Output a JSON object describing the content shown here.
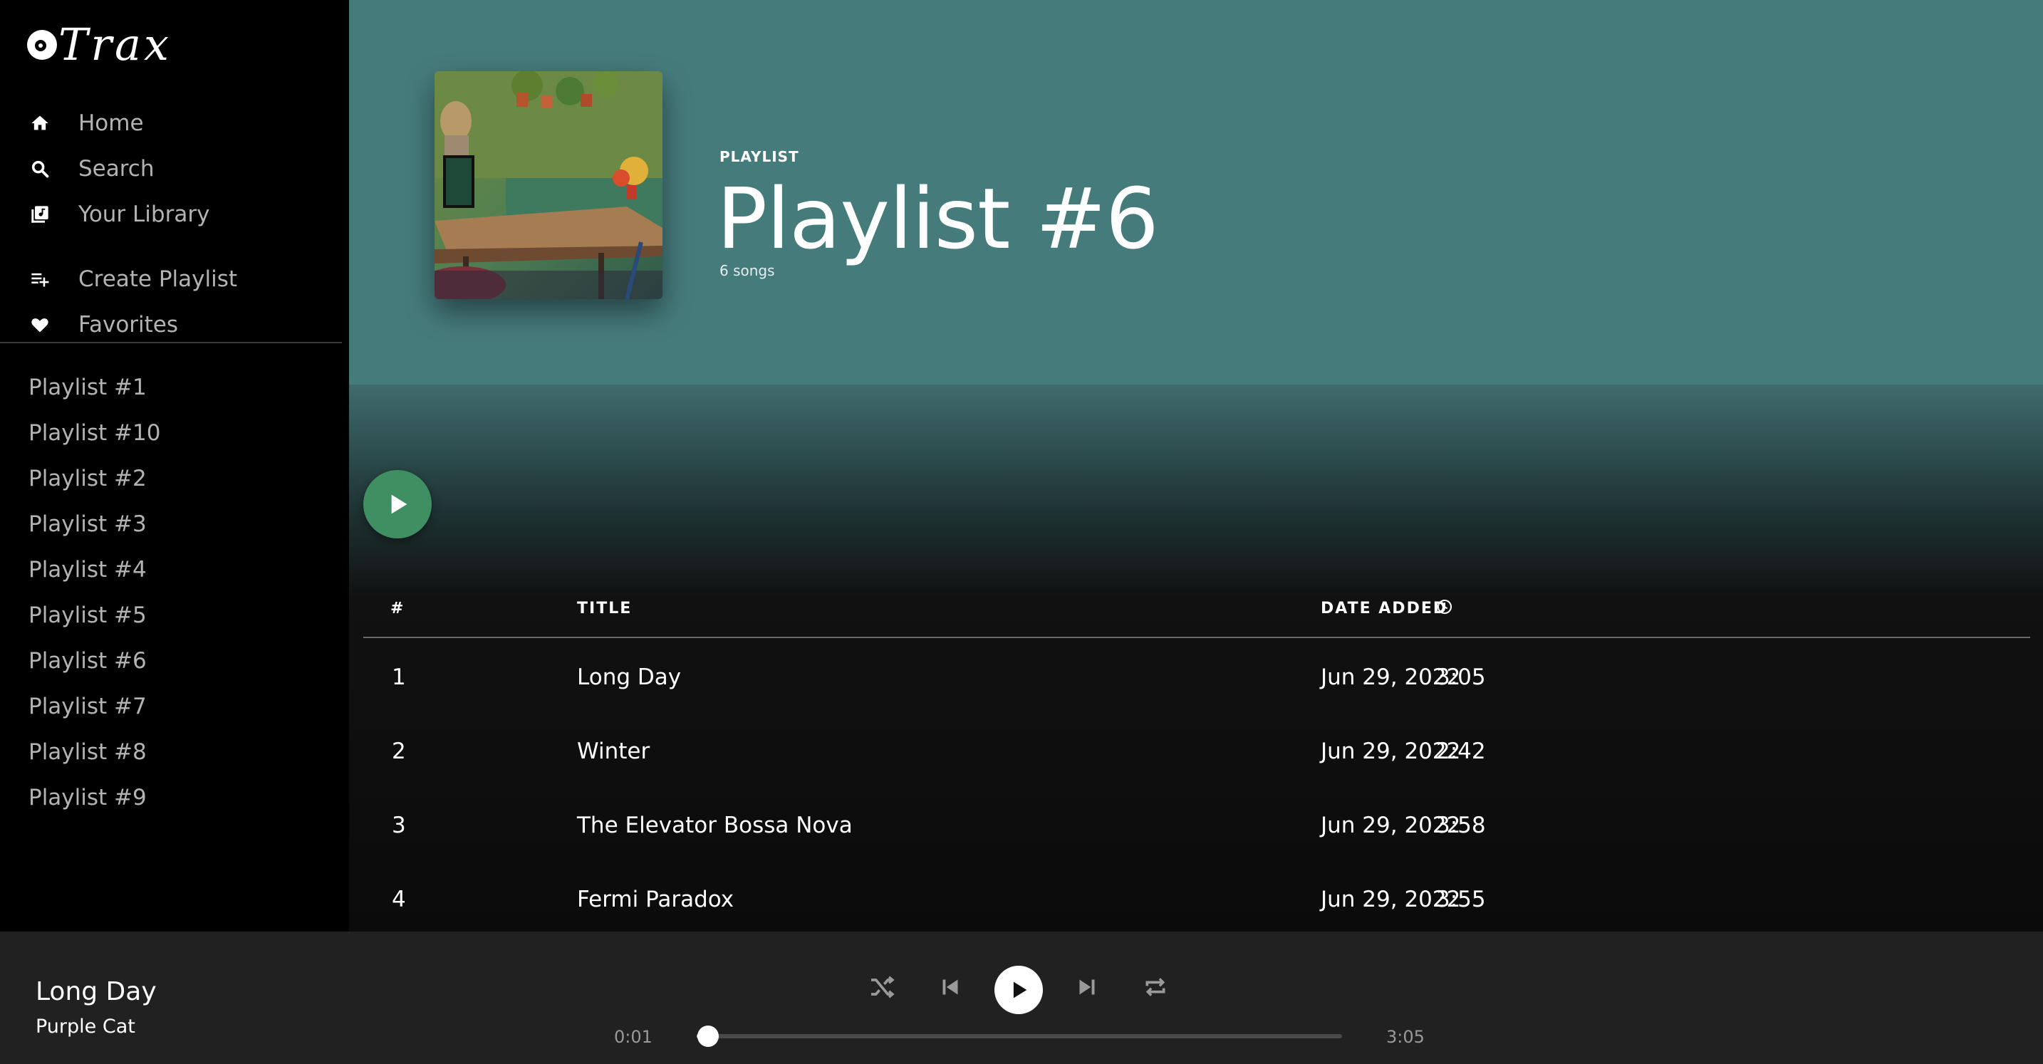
{
  "app": {
    "logo_text": "Trax"
  },
  "sidebar": {
    "nav": [
      {
        "label": "Home",
        "icon": "home-icon"
      },
      {
        "label": "Search",
        "icon": "search-icon"
      },
      {
        "label": "Your Library",
        "icon": "library-icon"
      }
    ],
    "actions": [
      {
        "label": "Create Playlist",
        "icon": "playlist-add-icon"
      },
      {
        "label": "Favorites",
        "icon": "heart-icon"
      }
    ],
    "playlists": [
      "Playlist #1",
      "Playlist #10",
      "Playlist #2",
      "Playlist #3",
      "Playlist #4",
      "Playlist #5",
      "Playlist #6",
      "Playlist #7",
      "Playlist #8",
      "Playlist #9"
    ]
  },
  "header": {
    "type_label": "PLAYLIST",
    "title": "Playlist #6",
    "song_count": "6 songs",
    "header_color": "#467b7c"
  },
  "table": {
    "columns": {
      "num": "#",
      "title": "TITLE",
      "date": "DATE ADDED",
      "duration_icon": "clock-icon"
    },
    "rows": [
      {
        "num": "1",
        "title": "Long Day",
        "date": "Jun 29, 2022",
        "duration": "3:05"
      },
      {
        "num": "2",
        "title": "Winter",
        "date": "Jun 29, 2022",
        "duration": "2:42"
      },
      {
        "num": "3",
        "title": "The Elevator Bossa Nova",
        "date": "Jun 29, 2022",
        "duration": "3:58"
      },
      {
        "num": "4",
        "title": "Fermi Paradox",
        "date": "Jun 29, 2022",
        "duration": "3:55"
      }
    ]
  },
  "player": {
    "song_title": "Long Day",
    "artist": "Purple Cat",
    "current_time": "0:01",
    "total_time": "3:05",
    "progress_fraction": 0.005,
    "play_accent": "#3f8f62"
  }
}
